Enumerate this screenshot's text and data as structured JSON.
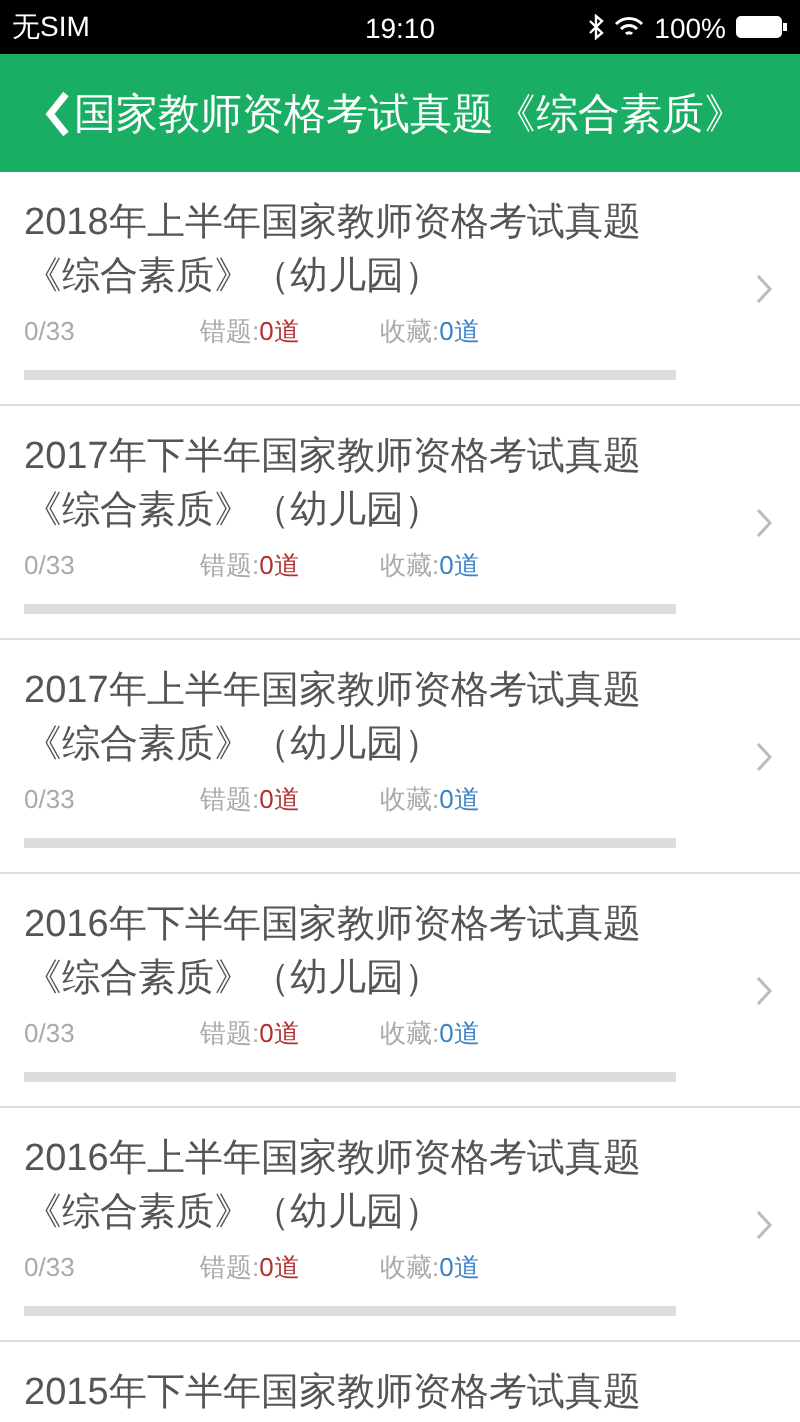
{
  "status_bar": {
    "carrier": "无SIM",
    "time": "19:10",
    "battery": "100%"
  },
  "header": {
    "title": "国家教师资格考试真题《综合素质》"
  },
  "papers": [
    {
      "title": "2018年上半年国家教师资格考试真题《综合素质》（幼儿园）",
      "progress": "0/33",
      "level": 0,
      "wrong_label": "错题:",
      "wrong_count": "0道",
      "fav_label": "收藏:",
      "fav_count": "0道"
    },
    {
      "title": "2017年下半年国家教师资格考试真题《综合素质》（幼儿园）",
      "progress": "0/33",
      "level": 0,
      "wrong_label": "错题:",
      "wrong_count": "0道",
      "fav_label": "收藏:",
      "fav_count": "0道"
    },
    {
      "title": "2017年上半年国家教师资格考试真题《综合素质》（幼儿园）",
      "progress": "0/33",
      "level": 0,
      "wrong_label": "错题:",
      "wrong_count": "0道",
      "fav_label": "收藏:",
      "fav_count": "0道"
    },
    {
      "title": "2016年下半年国家教师资格考试真题《综合素质》（幼儿园）",
      "progress": "0/33",
      "level": 0,
      "wrong_label": "错题:",
      "wrong_count": "0道",
      "fav_label": "收藏:",
      "fav_count": "0道"
    },
    {
      "title": "2016年上半年国家教师资格考试真题《综合素质》（幼儿园）",
      "progress": "0/33",
      "level": 0,
      "wrong_label": "错题:",
      "wrong_count": "0道",
      "fav_label": "收藏:",
      "fav_count": "0道"
    },
    {
      "title": "2015年下半年国家教师资格考试真题"
    }
  ]
}
